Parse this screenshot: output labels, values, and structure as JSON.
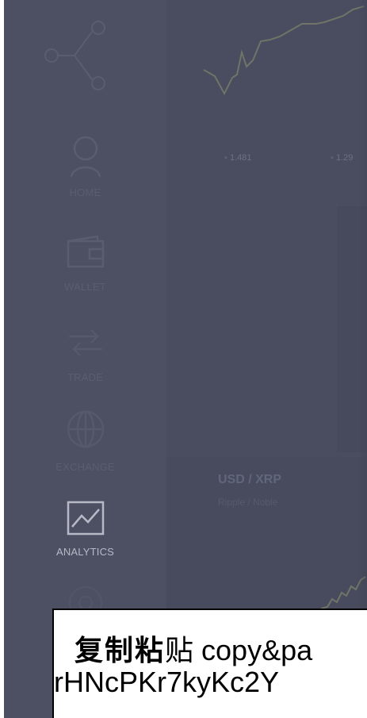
{
  "sidebar": {
    "items": [
      {
        "label": "HOME",
        "icon": "user-icon",
        "active": false
      },
      {
        "label": "WALLET",
        "icon": "wallet-icon",
        "active": false
      },
      {
        "label": "TRADE",
        "icon": "trade-icon",
        "active": false
      },
      {
        "label": "EXCHANGE",
        "icon": "globe-icon",
        "active": false
      },
      {
        "label": "ANALYTICS",
        "icon": "chart-icon",
        "active": true
      },
      {
        "label": "",
        "icon": "settings-icon",
        "active": false
      }
    ],
    "logo_icon": "network-nodes-icon"
  },
  "prices": [
    {
      "value": "1.481"
    },
    {
      "value": "1.29"
    }
  ],
  "pair": {
    "title": "USD / XRP",
    "subtitle": "Ripple / Noble"
  },
  "watermark": {
    "bold_text": "复制粘",
    "serif_text": "贴",
    "tail_text": " copy&pa",
    "line2": "rHNcPKr7kyKc2Y"
  },
  "colors": {
    "background": "#4b4e61",
    "sidebar": "#4d5063",
    "active_label": "#b7b9c6",
    "inactive_label": "#5a5d70"
  }
}
